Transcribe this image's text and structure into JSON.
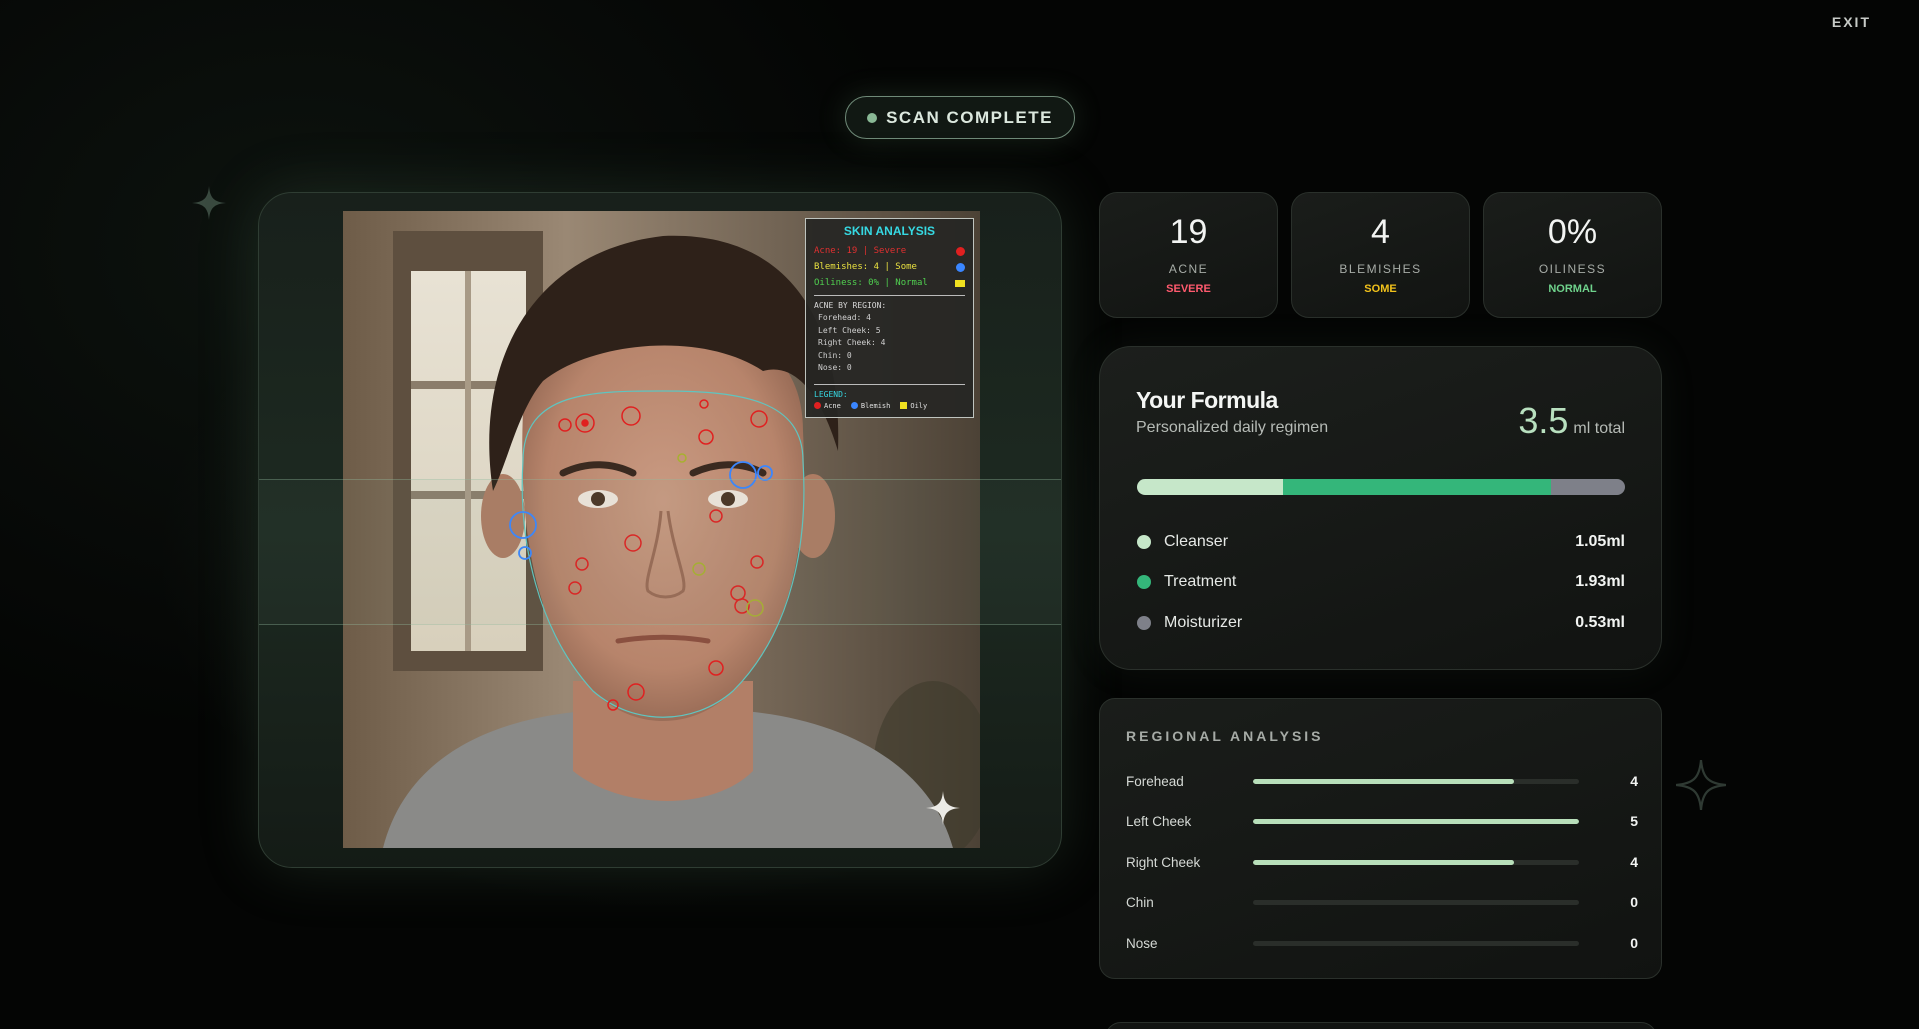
{
  "header": {
    "exit_label": "EXIT"
  },
  "status": {
    "label": "SCAN COMPLETE"
  },
  "overlay": {
    "title": "SKIN ANALYSIS",
    "rows": [
      {
        "text": "Acne: 19  |  Severe",
        "color": "#e03030"
      },
      {
        "text": "Blemishes: 4  |  Some",
        "color": "#e8e040"
      },
      {
        "text": "Oiliness: 0%  |  Normal",
        "color": "#50d050"
      }
    ],
    "swatch_colors": [
      "#e02020",
      "#3a86ff",
      "#f0e020"
    ],
    "region_heading": "ACNE BY REGION:",
    "region_items": [
      "Forehead: 4",
      "Left Cheek: 5",
      "Right Cheek: 4",
      "Chin: 0",
      "Nose: 0"
    ],
    "legend_title": "LEGEND:",
    "legend": [
      {
        "label": "Acne",
        "color": "#e02020"
      },
      {
        "label": "Blemish",
        "color": "#3a86ff"
      },
      {
        "label": "Oily",
        "color": "#f0e020"
      }
    ]
  },
  "stats": [
    {
      "value": "19",
      "label": "ACNE",
      "level": "SEVERE",
      "level_color": "#ff5a6e"
    },
    {
      "value": "4",
      "label": "BLEMISHES",
      "level": "SOME",
      "level_color": "#f2c21b"
    },
    {
      "value": "0%",
      "label": "OILINESS",
      "level": "NORMAL",
      "level_color": "#6fd38c"
    }
  ],
  "formula": {
    "title": "Your Formula",
    "subtitle": "Personalized daily regimen",
    "total_value": "3.5",
    "total_unit": "ml total",
    "items": [
      {
        "name": "Cleanser",
        "amount": "1.05ml",
        "ml": 1.05,
        "color": "#c6e7c9"
      },
      {
        "name": "Treatment",
        "amount": "1.93ml",
        "ml": 1.93,
        "color": "#34b67a"
      },
      {
        "name": "Moisturizer",
        "amount": "0.53ml",
        "ml": 0.53,
        "color": "#7e8089"
      }
    ]
  },
  "regional": {
    "title": "REGIONAL ANALYSIS",
    "max": 5,
    "rows": [
      {
        "name": "Forehead",
        "value": 4
      },
      {
        "name": "Left Cheek",
        "value": 5
      },
      {
        "name": "Right Cheek",
        "value": 4
      },
      {
        "name": "Chin",
        "value": 0
      },
      {
        "name": "Nose",
        "value": 0
      }
    ]
  }
}
